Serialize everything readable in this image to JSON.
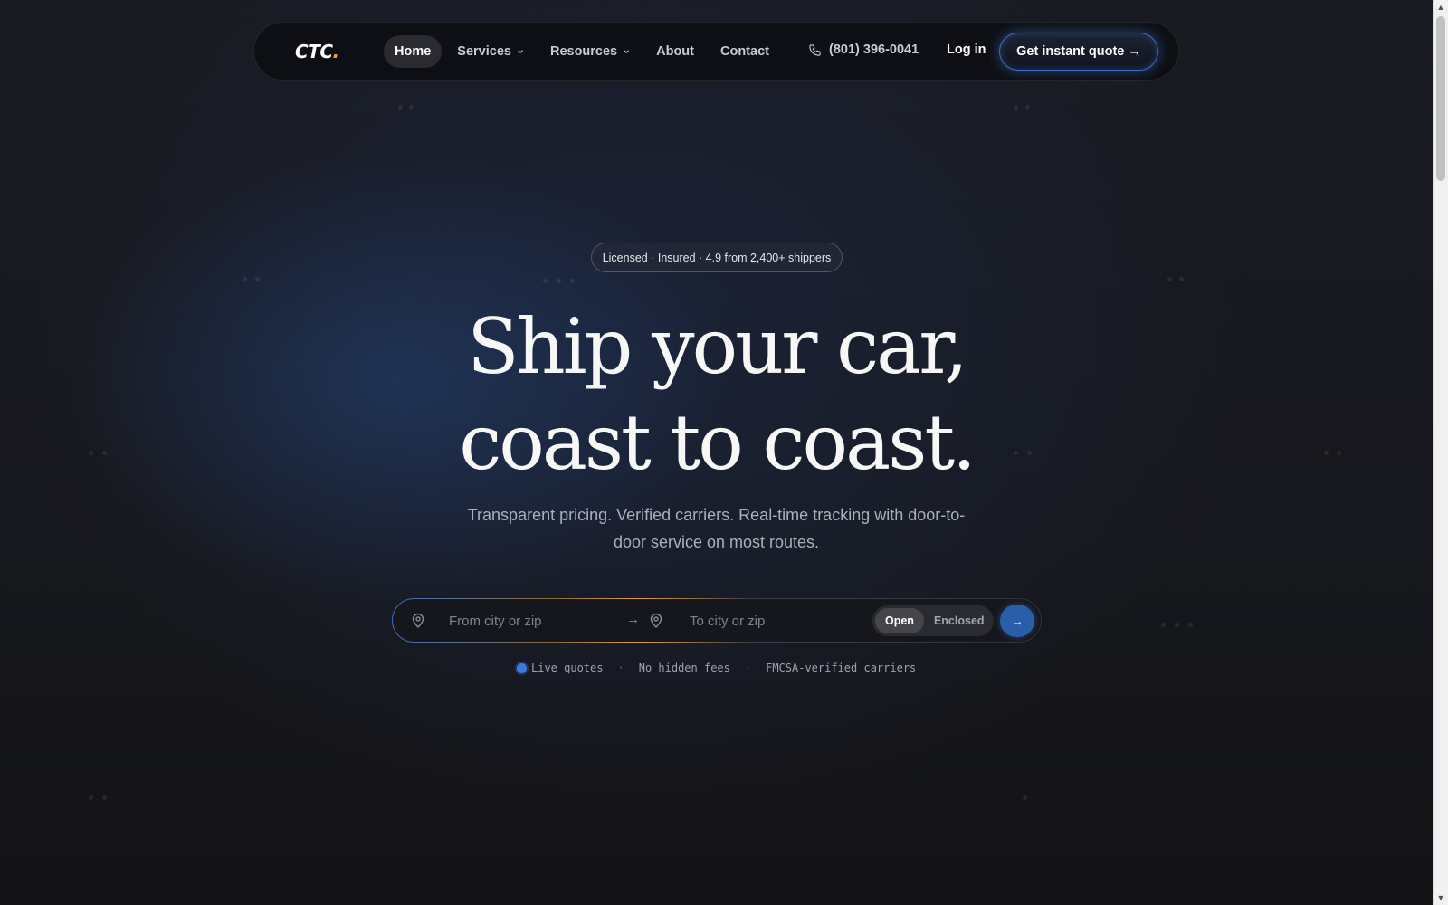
{
  "brand": {
    "logo_text": "CTC",
    "logo_dot": ".",
    "accent": "#e8a33c"
  },
  "nav": {
    "items": [
      {
        "label": "Home",
        "active": true
      },
      {
        "label": "Services",
        "dropdown": true
      },
      {
        "label": "Resources",
        "dropdown": true
      },
      {
        "label": "About"
      },
      {
        "label": "Contact"
      }
    ],
    "phone": "(801) 396-0041",
    "login": "Log in",
    "cta": "Get instant quote →"
  },
  "hero": {
    "badge": "Licensed · Insured · 4.9 from 2,400+ shippers",
    "headline_line1": "Ship your car,",
    "headline_line2": "coast to coast.",
    "subtext": "Transparent pricing. Verified carriers. Real-time tracking with door-to-door service on most routes."
  },
  "search": {
    "from_placeholder": "From city or zip",
    "from_value": "",
    "arrow": "→",
    "to_placeholder": "To city or zip",
    "to_value": "",
    "transport_options": [
      "Open",
      "Enclosed"
    ],
    "transport_selected": "Open",
    "submit_arrow": "→"
  },
  "features": {
    "items": [
      "Live quotes",
      "No hidden fees",
      "FMCSA-verified carriers"
    ],
    "separator": "·"
  },
  "colors": {
    "primary": "#2b5ea8",
    "live_dot": "#3b7be0",
    "background": "#17171b"
  }
}
